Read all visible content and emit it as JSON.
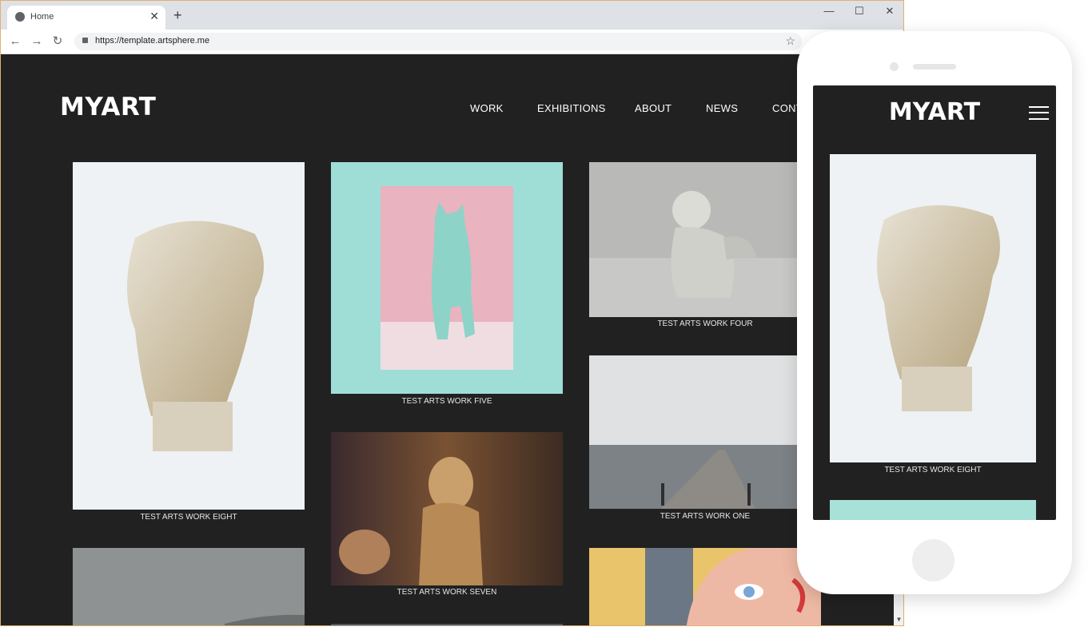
{
  "browser": {
    "tab_title": "Home",
    "tab_close": "✕",
    "new_tab": "+",
    "window_controls": {
      "minimize": "—",
      "maximize": "☐",
      "close": "✕"
    },
    "nav": {
      "back": "←",
      "forward": "→",
      "reload": "↻"
    },
    "url": "https://template.artsphere.me",
    "bookmark": "☆"
  },
  "site": {
    "logo": "MYART",
    "nav": [
      "WORK",
      "EXHIBITIONS",
      "ABOUT",
      "NEWS",
      "CONT"
    ],
    "works": [
      {
        "caption": "TEST ARTS WORK EIGHT"
      },
      {
        "caption": "TEST ARTS WORK FIVE"
      },
      {
        "caption": "TEST ARTS WORK FOUR"
      },
      {
        "caption": "TEST ARTS WORK ONE"
      },
      {
        "caption": "TEST ARTS WORK SEVEN"
      }
    ]
  },
  "mobile": {
    "logo": "MYART",
    "caption": "TEST ARTS WORK EIGHT"
  },
  "colors": {
    "page_bg": "#212121",
    "text": "#ffffff",
    "browser_chrome": "#dee1e6",
    "window_border": "#e3b06a"
  },
  "icons": [
    "globe-icon",
    "close-icon",
    "plus-icon",
    "minimize-icon",
    "maximize-icon",
    "back-arrow-icon",
    "forward-arrow-icon",
    "reload-icon",
    "lock-icon",
    "star-icon",
    "hamburger-menu-icon",
    "scroll-down-arrow-icon"
  ]
}
